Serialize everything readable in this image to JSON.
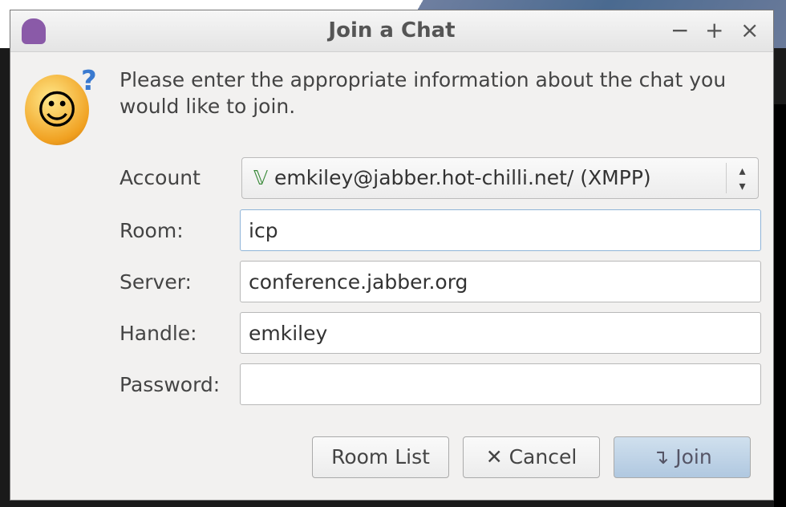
{
  "window": {
    "title": "Join a Chat",
    "minimize": "−",
    "maximize": "+",
    "close": "×"
  },
  "message": "Please enter the appropriate information about the chat you would like to join.",
  "form": {
    "account_label": "Account",
    "account_value": "emkiley@jabber.hot-chilli.net/ (XMPP)",
    "room_label": "Room:",
    "room_value": "icp",
    "server_label": "Server:",
    "server_value": "conference.jabber.org",
    "handle_label": "Handle:",
    "handle_value": "emkiley",
    "password_label": "Password:",
    "password_value": ""
  },
  "buttons": {
    "room_list": "Room List",
    "cancel": "Cancel",
    "join": "Join",
    "cancel_icon": "✕",
    "join_icon": "↴"
  }
}
